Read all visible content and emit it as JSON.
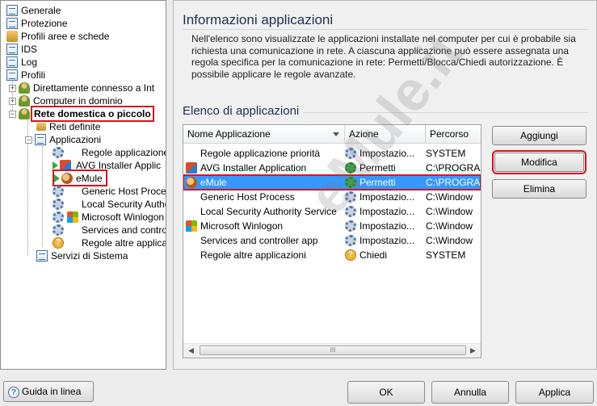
{
  "tree": {
    "items": [
      {
        "label": "Generale",
        "icon": "document-icon"
      },
      {
        "label": "Protezione",
        "icon": "document-icon"
      },
      {
        "label": "Profili aree e schede",
        "icon": "network-icon"
      },
      {
        "label": "IDS",
        "icon": "document-icon"
      },
      {
        "label": "Log",
        "icon": "document-icon"
      },
      {
        "label": "Profili",
        "icon": "document-icon"
      },
      {
        "label": "Direttamente connesso a Int",
        "icon": "user-icon"
      },
      {
        "label": "Computer in dominio",
        "icon": "user-icon"
      },
      {
        "label": "Rete domestica o piccolo",
        "icon": "user-icon"
      },
      {
        "label": "Reti definite",
        "icon": "network-icon"
      },
      {
        "label": "Applicazioni",
        "icon": "document-icon"
      },
      {
        "label": "Regole applicazione",
        "icon": "gear-icon"
      },
      {
        "label": "AVG Installer Applic",
        "icon": "avg-icon"
      },
      {
        "label": "eMule",
        "icon": "emule-icon"
      },
      {
        "label": "Generic Host Proce",
        "icon": "gear-icon"
      },
      {
        "label": "Local Security Autho",
        "icon": "gear-icon"
      },
      {
        "label": "Microsoft Winlogon",
        "icon": "windows-icon"
      },
      {
        "label": "Services and contro",
        "icon": "gear-icon"
      },
      {
        "label": "Regole altre applica",
        "icon": "question-icon"
      },
      {
        "label": "Servizi di Sistema",
        "icon": "document-icon"
      }
    ]
  },
  "main": {
    "title": "Informazioni applicazioni",
    "description": "Nell'elenco sono visualizzate le applicazioni installate nel computer per cui è probabile sia richiesta una comunicazione in rete. A ciascuna applicazione può essere assegnata una regola specifica per la comunicazione in rete: Permetti/Blocca/Chiedi autorizzazione. È possibile applicare le regole avanzate.",
    "list_title": "Elenco di applicazioni",
    "columns": [
      "Nome Applicazione",
      "Azione",
      "Percorso"
    ],
    "rows": [
      {
        "name": "Regole applicazione priorità",
        "action": "Impostazio...",
        "path": "SYSTEM",
        "icon": "gear-icon",
        "action_icon": "gear-icon"
      },
      {
        "name": "AVG Installer Application",
        "action": "Permetti",
        "path": "C:\\PROGRA",
        "icon": "avg-icon",
        "action_icon": "allow-icon"
      },
      {
        "name": "eMule",
        "action": "Permetti",
        "path": "C:\\PROGRA",
        "icon": "emule-icon",
        "action_icon": "allow-icon"
      },
      {
        "name": "Generic Host Process",
        "action": "Impostazio...",
        "path": "C:\\Window",
        "icon": "",
        "action_icon": "gear-icon"
      },
      {
        "name": "Local Security Authority Service",
        "action": "Impostazio...",
        "path": "C:\\Window",
        "icon": "",
        "action_icon": "gear-icon"
      },
      {
        "name": "Microsoft Winlogon",
        "action": "Impostazio...",
        "path": "C:\\Window",
        "icon": "windows-icon",
        "action_icon": "gear-icon"
      },
      {
        "name": "Services and controller app",
        "action": "Impostazio...",
        "path": "C:\\Window",
        "icon": "",
        "action_icon": "gear-icon"
      },
      {
        "name": "Regole altre applicazioni",
        "action": "Chiedi",
        "path": "SYSTEM",
        "icon": "",
        "action_icon": "question-icon"
      }
    ],
    "scroll_thumb": "III",
    "buttons": {
      "add": "Aggiungi",
      "edit": "Modifica",
      "delete": "Elimina"
    },
    "watermark": "eMule.it"
  },
  "footer": {
    "help": "Guida in linea",
    "ok": "OK",
    "cancel": "Annulla",
    "apply": "Applica"
  },
  "colors": {
    "selection": "#3399ff",
    "highlight_box": "#d8141c",
    "title": "#1e3050"
  }
}
